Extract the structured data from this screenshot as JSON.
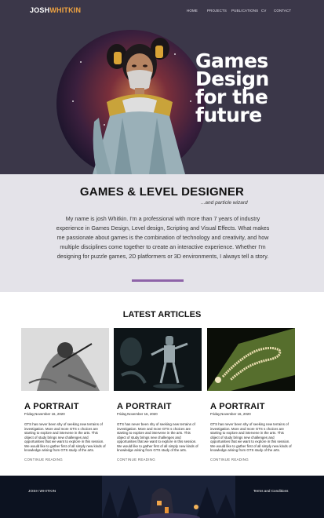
{
  "header": {
    "logo_first": "JOSH",
    "logo_second": "WHITKIN",
    "nav": [
      "HOME",
      "PROJECTS",
      "PUBLICATIONS",
      "CV",
      "CONTACT"
    ]
  },
  "hero": {
    "title_lines": [
      "Games",
      "Design",
      "for the",
      "future"
    ]
  },
  "intro": {
    "role": "GAMES & LEVEL DESIGNER",
    "subtitle": "...and particle wizard",
    "bio": "My name is josh Whitkin. I'm a professional with more than 7 years of industry experience in Games Design, Level design, Scripting and Visual Effects. What makes me passionate about games is the combination of technology and creativity, and how multiple disciplines come together to create an interactive experience. Whether I'm designing for puzzle games, 2D platformers or 3D environments, I always tell a story."
  },
  "articles": {
    "heading": "LATEST ARTICLES",
    "items": [
      {
        "title": "A PORTRAIT",
        "date": "Friday,November 16, 2020",
        "body": "GTS has never been shy of seeking new terrains of investigation. More and more GTS s choices are starting to explore and intervene in the arts. This object of study brings new challenges and opportunities that we want to explore in this session. We would like to gather first of all simply new kinds of knowledge arising from GTS study of the arts.",
        "more": "CONTINUE READING"
      },
      {
        "title": "A PORTRAIT",
        "date": "Friday,November 16, 2020",
        "body": "GTS has never been shy of seeking new terrains of investigation. More and more GTS s choices are starting to explore and intervene in the arts. This object of study brings new challenges and opportunities that we want to explore in this session. We would like to gather first of all simply new kinds of knowledge arising from GTS study of the arts.",
        "more": "CONTINUE READING"
      },
      {
        "title": "A PORTRAIT",
        "date": "Friday,November 16, 2020",
        "body": "GTS has never been shy of seeking new terrains of investigation. More and more GTS s choices are starting to explore and intervene in the arts. This object of study brings new challenges and opportunities that we want to explore in this session. We would like to gather first of all simply new kinds of knowledge arising from GTS study of the arts.",
        "more": "CONTINUE READING"
      }
    ]
  },
  "footer": {
    "name": "JOSH WHITKIN",
    "terms": "Terms and Conditions"
  },
  "colors": {
    "hero_bg": "#3b3749",
    "logo_accent": "#f2a541",
    "intro_bg": "#e4e3e9",
    "divider": "#8e63a8",
    "footer_bg": "#0c1220"
  }
}
